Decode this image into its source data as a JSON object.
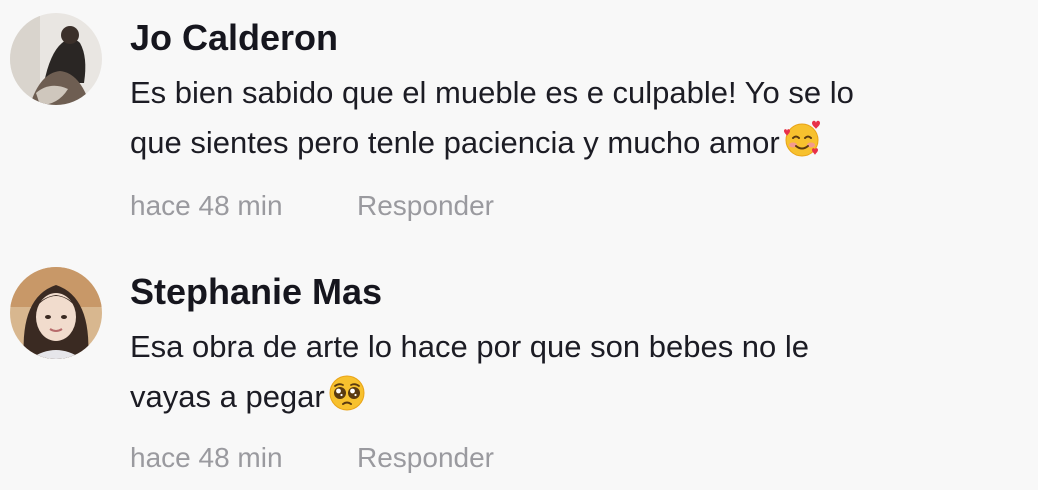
{
  "comments": [
    {
      "author": "Jo Calderon",
      "text_lines": [
        "Es bien sabido que el mueble es e culpable! Yo se lo",
        "que sientes pero tenle paciencia y mucho amor"
      ],
      "emoji": "smiling-face-with-hearts-emoji",
      "time": "hace 48 min",
      "reply_label": "Responder"
    },
    {
      "author": "Stephanie Mas",
      "text_lines": [
        "Esa obra de arte lo hace por que son bebes no le",
        "vayas a pegar"
      ],
      "emoji": "pleading-face-emoji",
      "time": "hace 48 min",
      "reply_label": "Responder"
    }
  ],
  "colors": {
    "background": "#f8f8f8",
    "author": "#16161e",
    "body_text": "#1c1c24",
    "meta_text": "#9a9a9f"
  }
}
